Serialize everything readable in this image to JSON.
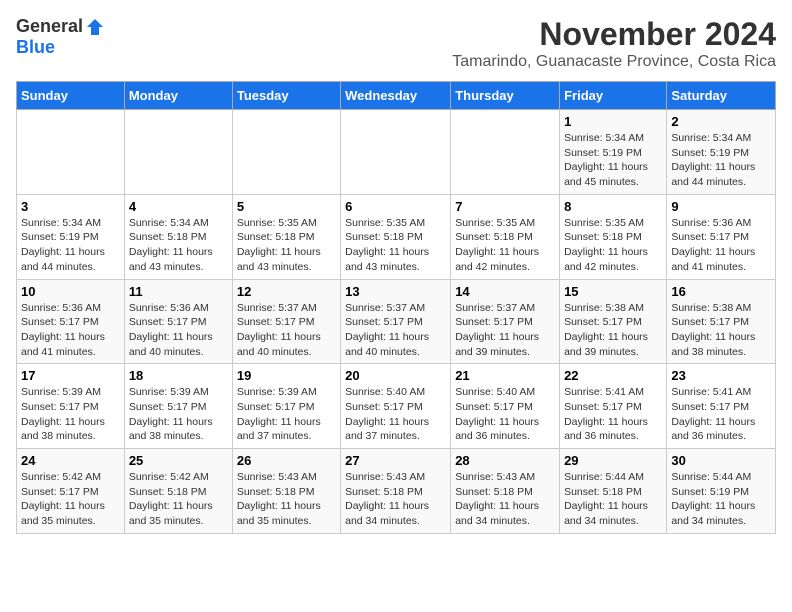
{
  "logo": {
    "general": "General",
    "blue": "Blue"
  },
  "title": "November 2024",
  "location": "Tamarindo, Guanacaste Province, Costa Rica",
  "days_header": [
    "Sunday",
    "Monday",
    "Tuesday",
    "Wednesday",
    "Thursday",
    "Friday",
    "Saturday"
  ],
  "weeks": [
    [
      {
        "day": "",
        "info": ""
      },
      {
        "day": "",
        "info": ""
      },
      {
        "day": "",
        "info": ""
      },
      {
        "day": "",
        "info": ""
      },
      {
        "day": "",
        "info": ""
      },
      {
        "day": "1",
        "info": "Sunrise: 5:34 AM\nSunset: 5:19 PM\nDaylight: 11 hours\nand 45 minutes."
      },
      {
        "day": "2",
        "info": "Sunrise: 5:34 AM\nSunset: 5:19 PM\nDaylight: 11 hours\nand 44 minutes."
      }
    ],
    [
      {
        "day": "3",
        "info": "Sunrise: 5:34 AM\nSunset: 5:19 PM\nDaylight: 11 hours\nand 44 minutes."
      },
      {
        "day": "4",
        "info": "Sunrise: 5:34 AM\nSunset: 5:18 PM\nDaylight: 11 hours\nand 43 minutes."
      },
      {
        "day": "5",
        "info": "Sunrise: 5:35 AM\nSunset: 5:18 PM\nDaylight: 11 hours\nand 43 minutes."
      },
      {
        "day": "6",
        "info": "Sunrise: 5:35 AM\nSunset: 5:18 PM\nDaylight: 11 hours\nand 43 minutes."
      },
      {
        "day": "7",
        "info": "Sunrise: 5:35 AM\nSunset: 5:18 PM\nDaylight: 11 hours\nand 42 minutes."
      },
      {
        "day": "8",
        "info": "Sunrise: 5:35 AM\nSunset: 5:18 PM\nDaylight: 11 hours\nand 42 minutes."
      },
      {
        "day": "9",
        "info": "Sunrise: 5:36 AM\nSunset: 5:17 PM\nDaylight: 11 hours\nand 41 minutes."
      }
    ],
    [
      {
        "day": "10",
        "info": "Sunrise: 5:36 AM\nSunset: 5:17 PM\nDaylight: 11 hours\nand 41 minutes."
      },
      {
        "day": "11",
        "info": "Sunrise: 5:36 AM\nSunset: 5:17 PM\nDaylight: 11 hours\nand 40 minutes."
      },
      {
        "day": "12",
        "info": "Sunrise: 5:37 AM\nSunset: 5:17 PM\nDaylight: 11 hours\nand 40 minutes."
      },
      {
        "day": "13",
        "info": "Sunrise: 5:37 AM\nSunset: 5:17 PM\nDaylight: 11 hours\nand 40 minutes."
      },
      {
        "day": "14",
        "info": "Sunrise: 5:37 AM\nSunset: 5:17 PM\nDaylight: 11 hours\nand 39 minutes."
      },
      {
        "day": "15",
        "info": "Sunrise: 5:38 AM\nSunset: 5:17 PM\nDaylight: 11 hours\nand 39 minutes."
      },
      {
        "day": "16",
        "info": "Sunrise: 5:38 AM\nSunset: 5:17 PM\nDaylight: 11 hours\nand 38 minutes."
      }
    ],
    [
      {
        "day": "17",
        "info": "Sunrise: 5:39 AM\nSunset: 5:17 PM\nDaylight: 11 hours\nand 38 minutes."
      },
      {
        "day": "18",
        "info": "Sunrise: 5:39 AM\nSunset: 5:17 PM\nDaylight: 11 hours\nand 38 minutes."
      },
      {
        "day": "19",
        "info": "Sunrise: 5:39 AM\nSunset: 5:17 PM\nDaylight: 11 hours\nand 37 minutes."
      },
      {
        "day": "20",
        "info": "Sunrise: 5:40 AM\nSunset: 5:17 PM\nDaylight: 11 hours\nand 37 minutes."
      },
      {
        "day": "21",
        "info": "Sunrise: 5:40 AM\nSunset: 5:17 PM\nDaylight: 11 hours\nand 36 minutes."
      },
      {
        "day": "22",
        "info": "Sunrise: 5:41 AM\nSunset: 5:17 PM\nDaylight: 11 hours\nand 36 minutes."
      },
      {
        "day": "23",
        "info": "Sunrise: 5:41 AM\nSunset: 5:17 PM\nDaylight: 11 hours\nand 36 minutes."
      }
    ],
    [
      {
        "day": "24",
        "info": "Sunrise: 5:42 AM\nSunset: 5:17 PM\nDaylight: 11 hours\nand 35 minutes."
      },
      {
        "day": "25",
        "info": "Sunrise: 5:42 AM\nSunset: 5:18 PM\nDaylight: 11 hours\nand 35 minutes."
      },
      {
        "day": "26",
        "info": "Sunrise: 5:43 AM\nSunset: 5:18 PM\nDaylight: 11 hours\nand 35 minutes."
      },
      {
        "day": "27",
        "info": "Sunrise: 5:43 AM\nSunset: 5:18 PM\nDaylight: 11 hours\nand 34 minutes."
      },
      {
        "day": "28",
        "info": "Sunrise: 5:43 AM\nSunset: 5:18 PM\nDaylight: 11 hours\nand 34 minutes."
      },
      {
        "day": "29",
        "info": "Sunrise: 5:44 AM\nSunset: 5:18 PM\nDaylight: 11 hours\nand 34 minutes."
      },
      {
        "day": "30",
        "info": "Sunrise: 5:44 AM\nSunset: 5:19 PM\nDaylight: 11 hours\nand 34 minutes."
      }
    ]
  ]
}
